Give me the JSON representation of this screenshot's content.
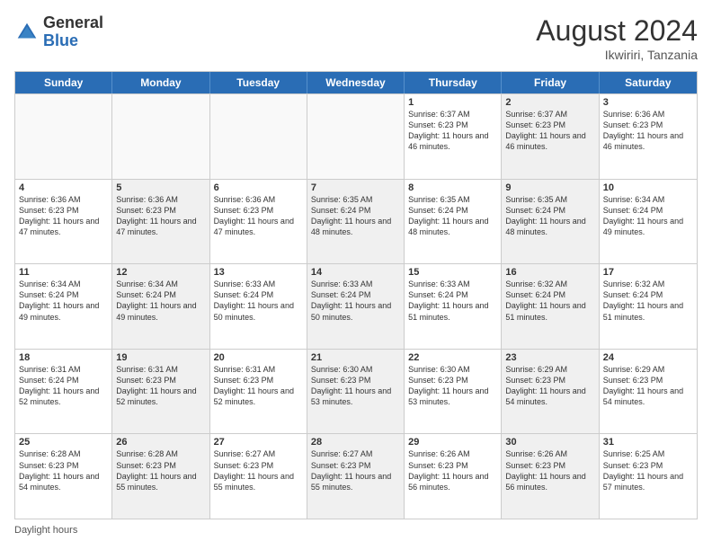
{
  "header": {
    "logo_general": "General",
    "logo_blue": "Blue",
    "month_title": "August 2024",
    "subtitle": "Ikwiriri, Tanzania"
  },
  "weekdays": [
    "Sunday",
    "Monday",
    "Tuesday",
    "Wednesday",
    "Thursday",
    "Friday",
    "Saturday"
  ],
  "footer_text": "Daylight hours",
  "rows": [
    [
      {
        "day": "",
        "text": "",
        "empty": true
      },
      {
        "day": "",
        "text": "",
        "empty": true
      },
      {
        "day": "",
        "text": "",
        "empty": true
      },
      {
        "day": "",
        "text": "",
        "empty": true
      },
      {
        "day": "1",
        "text": "Sunrise: 6:37 AM\nSunset: 6:23 PM\nDaylight: 11 hours and 46 minutes.",
        "empty": false,
        "shaded": false
      },
      {
        "day": "2",
        "text": "Sunrise: 6:37 AM\nSunset: 6:23 PM\nDaylight: 11 hours and 46 minutes.",
        "empty": false,
        "shaded": true
      },
      {
        "day": "3",
        "text": "Sunrise: 6:36 AM\nSunset: 6:23 PM\nDaylight: 11 hours and 46 minutes.",
        "empty": false,
        "shaded": false
      }
    ],
    [
      {
        "day": "4",
        "text": "Sunrise: 6:36 AM\nSunset: 6:23 PM\nDaylight: 11 hours and 47 minutes.",
        "empty": false,
        "shaded": false
      },
      {
        "day": "5",
        "text": "Sunrise: 6:36 AM\nSunset: 6:23 PM\nDaylight: 11 hours and 47 minutes.",
        "empty": false,
        "shaded": true
      },
      {
        "day": "6",
        "text": "Sunrise: 6:36 AM\nSunset: 6:23 PM\nDaylight: 11 hours and 47 minutes.",
        "empty": false,
        "shaded": false
      },
      {
        "day": "7",
        "text": "Sunrise: 6:35 AM\nSunset: 6:24 PM\nDaylight: 11 hours and 48 minutes.",
        "empty": false,
        "shaded": true
      },
      {
        "day": "8",
        "text": "Sunrise: 6:35 AM\nSunset: 6:24 PM\nDaylight: 11 hours and 48 minutes.",
        "empty": false,
        "shaded": false
      },
      {
        "day": "9",
        "text": "Sunrise: 6:35 AM\nSunset: 6:24 PM\nDaylight: 11 hours and 48 minutes.",
        "empty": false,
        "shaded": true
      },
      {
        "day": "10",
        "text": "Sunrise: 6:34 AM\nSunset: 6:24 PM\nDaylight: 11 hours and 49 minutes.",
        "empty": false,
        "shaded": false
      }
    ],
    [
      {
        "day": "11",
        "text": "Sunrise: 6:34 AM\nSunset: 6:24 PM\nDaylight: 11 hours and 49 minutes.",
        "empty": false,
        "shaded": false
      },
      {
        "day": "12",
        "text": "Sunrise: 6:34 AM\nSunset: 6:24 PM\nDaylight: 11 hours and 49 minutes.",
        "empty": false,
        "shaded": true
      },
      {
        "day": "13",
        "text": "Sunrise: 6:33 AM\nSunset: 6:24 PM\nDaylight: 11 hours and 50 minutes.",
        "empty": false,
        "shaded": false
      },
      {
        "day": "14",
        "text": "Sunrise: 6:33 AM\nSunset: 6:24 PM\nDaylight: 11 hours and 50 minutes.",
        "empty": false,
        "shaded": true
      },
      {
        "day": "15",
        "text": "Sunrise: 6:33 AM\nSunset: 6:24 PM\nDaylight: 11 hours and 51 minutes.",
        "empty": false,
        "shaded": false
      },
      {
        "day": "16",
        "text": "Sunrise: 6:32 AM\nSunset: 6:24 PM\nDaylight: 11 hours and 51 minutes.",
        "empty": false,
        "shaded": true
      },
      {
        "day": "17",
        "text": "Sunrise: 6:32 AM\nSunset: 6:24 PM\nDaylight: 11 hours and 51 minutes.",
        "empty": false,
        "shaded": false
      }
    ],
    [
      {
        "day": "18",
        "text": "Sunrise: 6:31 AM\nSunset: 6:24 PM\nDaylight: 11 hours and 52 minutes.",
        "empty": false,
        "shaded": false
      },
      {
        "day": "19",
        "text": "Sunrise: 6:31 AM\nSunset: 6:23 PM\nDaylight: 11 hours and 52 minutes.",
        "empty": false,
        "shaded": true
      },
      {
        "day": "20",
        "text": "Sunrise: 6:31 AM\nSunset: 6:23 PM\nDaylight: 11 hours and 52 minutes.",
        "empty": false,
        "shaded": false
      },
      {
        "day": "21",
        "text": "Sunrise: 6:30 AM\nSunset: 6:23 PM\nDaylight: 11 hours and 53 minutes.",
        "empty": false,
        "shaded": true
      },
      {
        "day": "22",
        "text": "Sunrise: 6:30 AM\nSunset: 6:23 PM\nDaylight: 11 hours and 53 minutes.",
        "empty": false,
        "shaded": false
      },
      {
        "day": "23",
        "text": "Sunrise: 6:29 AM\nSunset: 6:23 PM\nDaylight: 11 hours and 54 minutes.",
        "empty": false,
        "shaded": true
      },
      {
        "day": "24",
        "text": "Sunrise: 6:29 AM\nSunset: 6:23 PM\nDaylight: 11 hours and 54 minutes.",
        "empty": false,
        "shaded": false
      }
    ],
    [
      {
        "day": "25",
        "text": "Sunrise: 6:28 AM\nSunset: 6:23 PM\nDaylight: 11 hours and 54 minutes.",
        "empty": false,
        "shaded": false
      },
      {
        "day": "26",
        "text": "Sunrise: 6:28 AM\nSunset: 6:23 PM\nDaylight: 11 hours and 55 minutes.",
        "empty": false,
        "shaded": true
      },
      {
        "day": "27",
        "text": "Sunrise: 6:27 AM\nSunset: 6:23 PM\nDaylight: 11 hours and 55 minutes.",
        "empty": false,
        "shaded": false
      },
      {
        "day": "28",
        "text": "Sunrise: 6:27 AM\nSunset: 6:23 PM\nDaylight: 11 hours and 55 minutes.",
        "empty": false,
        "shaded": true
      },
      {
        "day": "29",
        "text": "Sunrise: 6:26 AM\nSunset: 6:23 PM\nDaylight: 11 hours and 56 minutes.",
        "empty": false,
        "shaded": false
      },
      {
        "day": "30",
        "text": "Sunrise: 6:26 AM\nSunset: 6:23 PM\nDaylight: 11 hours and 56 minutes.",
        "empty": false,
        "shaded": true
      },
      {
        "day": "31",
        "text": "Sunrise: 6:25 AM\nSunset: 6:23 PM\nDaylight: 11 hours and 57 minutes.",
        "empty": false,
        "shaded": false
      }
    ]
  ]
}
